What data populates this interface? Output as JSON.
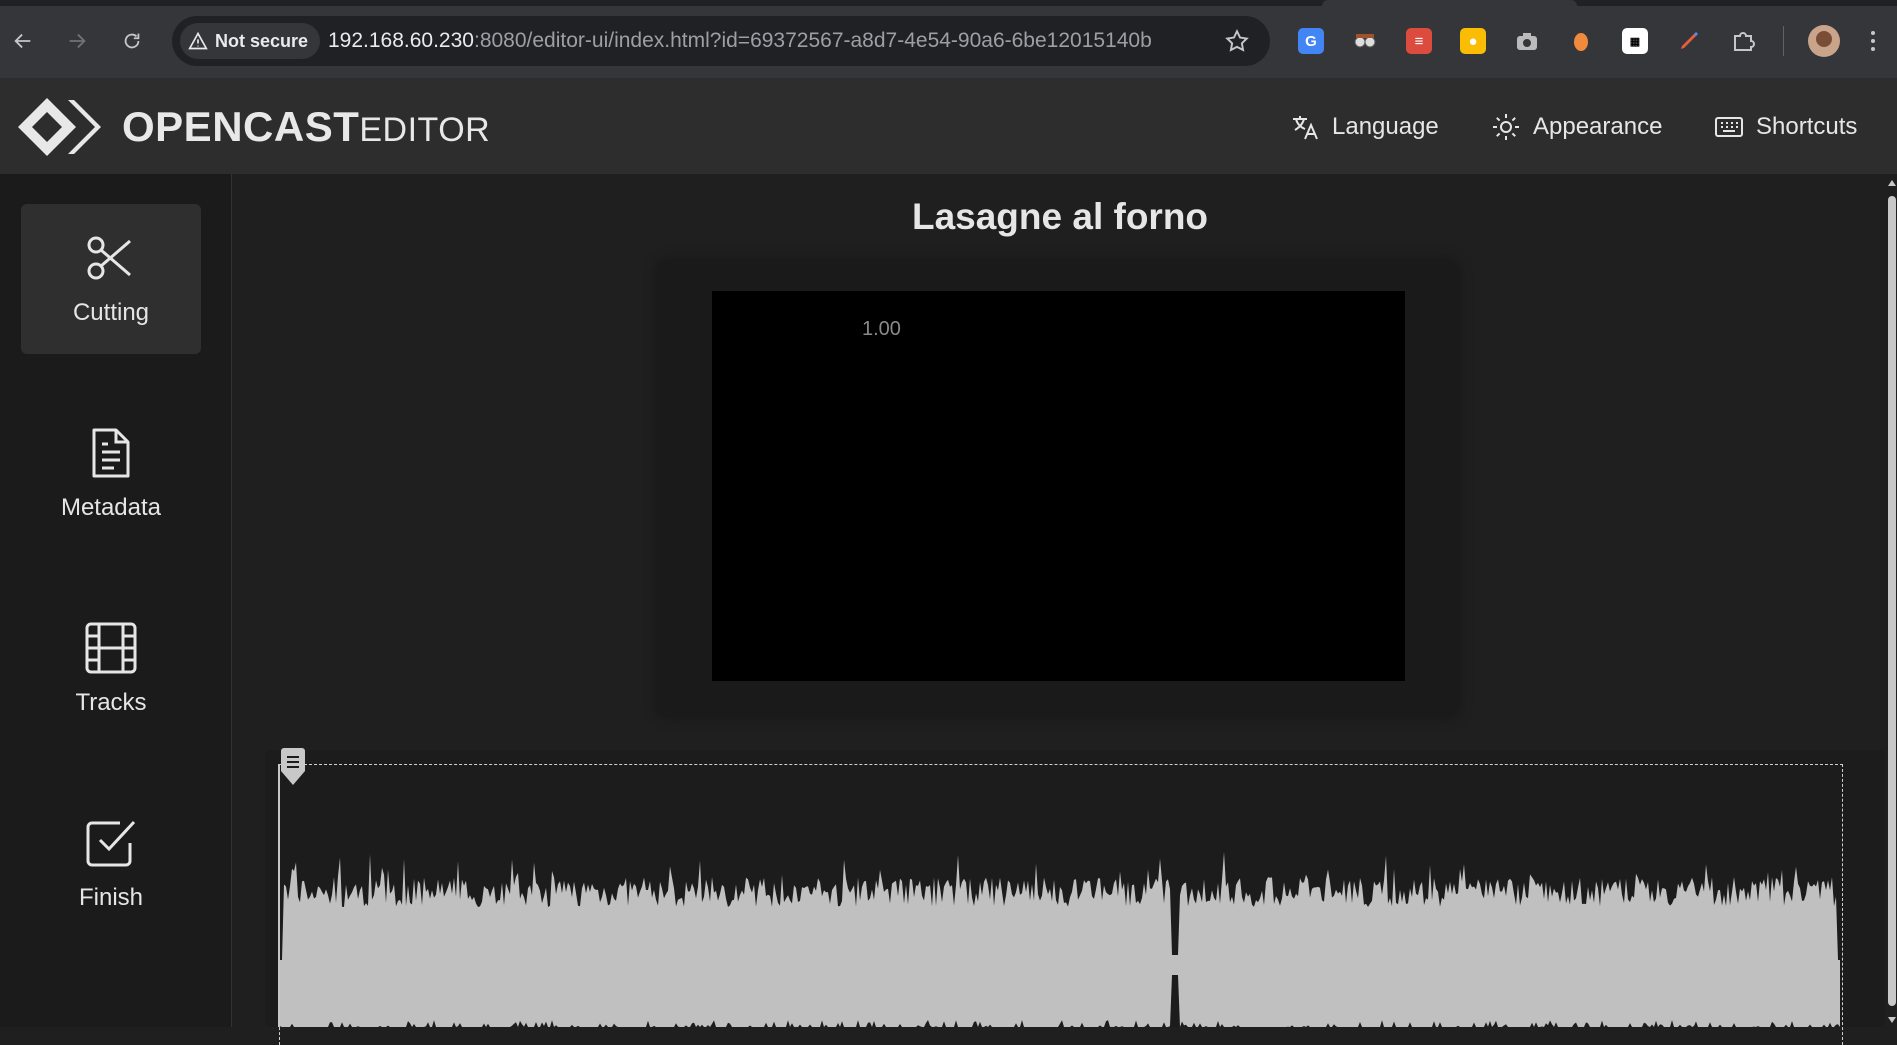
{
  "browser": {
    "security_label": "Not secure",
    "url_host": "192.168.60.230",
    "url_rest": ":8080/editor-ui/index.html?id=69372567-a8d7-4e54-90a6-6be12015140b",
    "icons": [
      "back-arrow-icon",
      "forward-arrow-icon",
      "reload-icon",
      "warning-triangle-icon",
      "bookmark-star-icon",
      "google-translate-icon",
      "spy-glasses-icon",
      "todoist-icon",
      "keep-note-icon",
      "camera-icon",
      "orange-dot-icon",
      "qr-code-icon",
      "pen-icon",
      "extensions-puzzle-icon",
      "profile-avatar",
      "kebab-menu-icon"
    ]
  },
  "header": {
    "logo_bold": "OPENCAST",
    "logo_light": "EDITOR",
    "language_label": "Language",
    "appearance_label": "Appearance",
    "shortcuts_label": "Shortcuts"
  },
  "sidebar": {
    "items": [
      {
        "label": "Cutting",
        "icon": "scissors-icon",
        "active": true
      },
      {
        "label": "Metadata",
        "icon": "document-icon",
        "active": false
      },
      {
        "label": "Tracks",
        "icon": "film-icon",
        "active": false
      },
      {
        "label": "Finish",
        "icon": "checkbox-icon",
        "active": false
      }
    ]
  },
  "main": {
    "title": "Lasagne al forno",
    "player": {
      "playback_rate": "1.00"
    }
  },
  "colors": {
    "app_background": "#1f1f1f",
    "header_background": "#2d2d2d",
    "sidebar_background": "#1b1b1b",
    "active_nav": "#2f2f2f",
    "waveform": "#c0c0c0"
  }
}
